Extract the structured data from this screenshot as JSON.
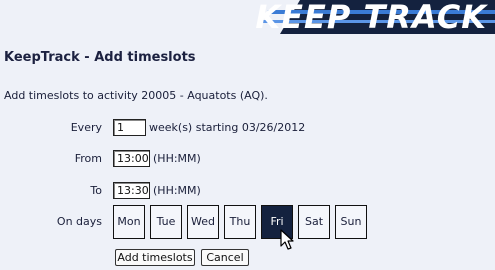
{
  "header": {
    "logo_text": "KEEP TRACK"
  },
  "page": {
    "title": "KeepTrack - Add timeslots",
    "intro": "Add timeslots to activity 20005 - Aquatots (AQ)."
  },
  "form": {
    "every": {
      "label": "Every",
      "value": "1",
      "suffix": "week(s) starting 03/26/2012"
    },
    "from": {
      "label": "From",
      "value": "13:00",
      "hint": "(HH:MM)"
    },
    "to": {
      "label": "To",
      "value": "13:30",
      "hint": "(HH:MM)"
    },
    "days": {
      "label": "On days",
      "items": [
        {
          "label": "Mon",
          "selected": false
        },
        {
          "label": "Tue",
          "selected": false
        },
        {
          "label": "Wed",
          "selected": false
        },
        {
          "label": "Thu",
          "selected": false
        },
        {
          "label": "Fri",
          "selected": true
        },
        {
          "label": "Sat",
          "selected": false
        },
        {
          "label": "Sun",
          "selected": false
        }
      ]
    },
    "add_label": "Add timeslots",
    "cancel_label": "Cancel"
  },
  "colors": {
    "navy": "#14223f",
    "accent": "#3a7bd5",
    "background": "#eef1f8"
  }
}
